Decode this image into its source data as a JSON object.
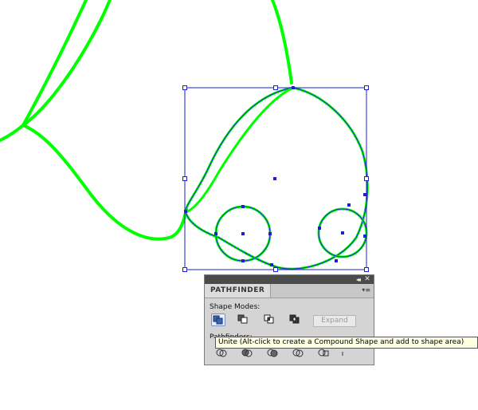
{
  "panel": {
    "tab_title": "PATHFINDER",
    "collapse_glyph": "◂◂",
    "close_glyph": "✕",
    "menu_glyph": "▾≡",
    "shape_modes_label": "Shape Modes:",
    "pathfinders_label": "Pathfinders:",
    "expand_label": "Expand",
    "tooltip": "Unite (Alt-click to create a Compound Shape and add to shape area)"
  },
  "colors": {
    "path_stroke": "#00ff00",
    "selection": "#1f1fd2",
    "panel_bg": "#d4d4d4",
    "titlebar": "#4b4b4b",
    "tooltip_bg": "#ffffe1"
  },
  "icons": {
    "unite": "unite-icon",
    "minus_front": "minus-front-icon",
    "intersect": "intersect-icon",
    "exclude": "exclude-icon"
  }
}
